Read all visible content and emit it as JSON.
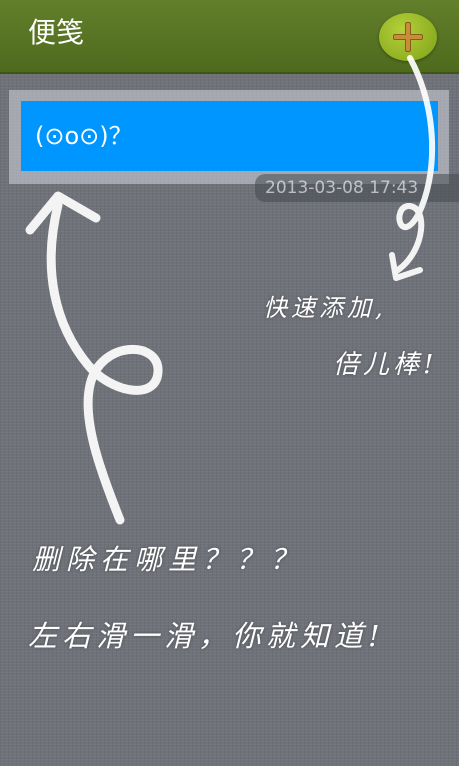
{
  "app": {
    "title": "便笺"
  },
  "toolbar": {
    "add_icon": "plus-icon"
  },
  "notes": [
    {
      "text": "(⊙o⊙)？",
      "timestamp": "2013-03-08 17:43"
    }
  ],
  "hints": {
    "quick_add_line1": "快速添加,",
    "quick_add_line2": "倍儿棒!",
    "delete_question": "删除在哪里？？？",
    "delete_answer": "左右滑一滑，你就知道!"
  },
  "colors": {
    "titlebar": "#5a7622",
    "add_button": "#9cbd2a",
    "note_card": "#0096ff",
    "background": "#6f7279"
  }
}
